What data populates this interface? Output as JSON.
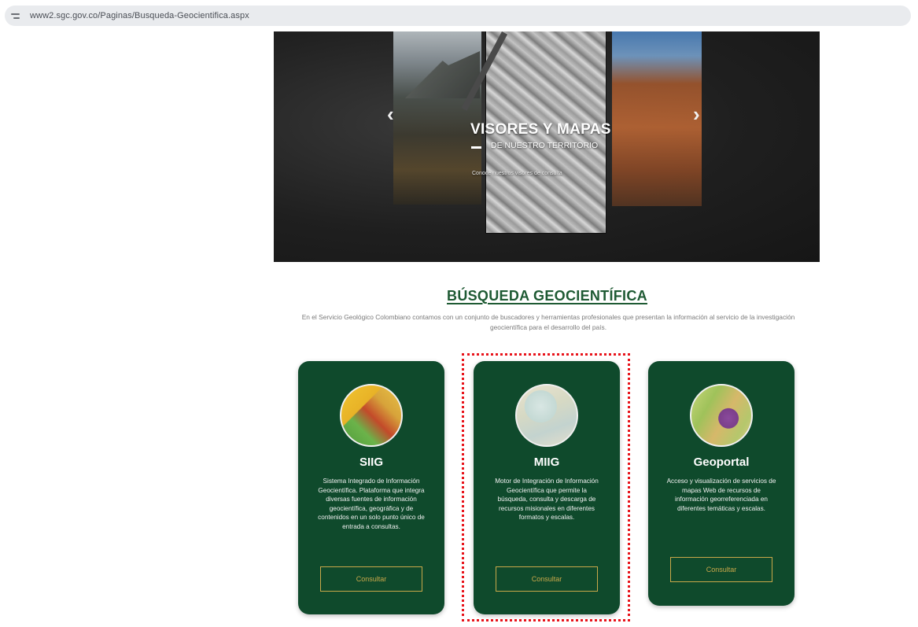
{
  "browser": {
    "url": "www2.sgc.gov.co/Paginas/Busqueda-Geocientifica.aspx"
  },
  "hero": {
    "title": "VISORES Y MAPAS",
    "subtitle": "DE NUESTRO TERRITORIO",
    "caption": "Conoce nuestros visores de consulta",
    "prev_arrow": "‹",
    "next_arrow": "›"
  },
  "section": {
    "title": "BÚSQUEDA GEOCIENTÍFICA",
    "description": "En el Servicio Geológico Colombiano contamos con un conjunto de buscadores y herramientas profesionales que presentan la información al servicio de la investigación geocientífica para el desarrollo del país."
  },
  "cards": [
    {
      "title": "SIIG",
      "description": "Sistema Integrado de Información Geocientífica. Plataforma que integra diversas fuentes de información geocientífica, geográfica y de contenidos en un solo punto único de entrada a consultas.",
      "button": "Consultar"
    },
    {
      "title": "MIIG",
      "description": "Motor de Integración de Información Geocientífica que permite la búsqueda, consulta y descarga de recursos misionales en diferentes formatos y escalas.",
      "button": "Consultar"
    },
    {
      "title": "Geoportal",
      "description": "Acceso y visualización de servicios de mapas Web de recursos de información georreferenciada en diferentes temáticas y escalas.",
      "button": "Consultar"
    }
  ],
  "colors": {
    "card_bg": "#0f4a2c",
    "heading": "#1e5a33",
    "button_border": "#c9a84a",
    "highlight": "#e8141b"
  }
}
